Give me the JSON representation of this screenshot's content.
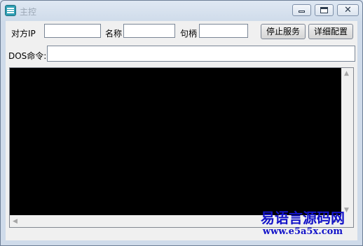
{
  "window": {
    "title": "主控",
    "controls": {
      "minimize": "minimize-icon",
      "maximize": "maximize-icon",
      "close": "close-icon",
      "close_glyph": "✕"
    }
  },
  "toolbar": {
    "ip_label": "对方IP",
    "ip_value": "",
    "name_label": "名称",
    "name_value": "",
    "handle_label": "句柄",
    "handle_value": "",
    "stop_button": "停止服务",
    "config_button": "详细配置"
  },
  "dos": {
    "label": "DOS命令:",
    "value": ""
  },
  "console": {
    "background": "#000000",
    "scroll_up": "▲",
    "scroll_down": "▼",
    "scroll_left": "◀",
    "scroll_right": "▶"
  },
  "watermark": {
    "main": "易语言源码网",
    "url": "www.e5a5x.com"
  }
}
